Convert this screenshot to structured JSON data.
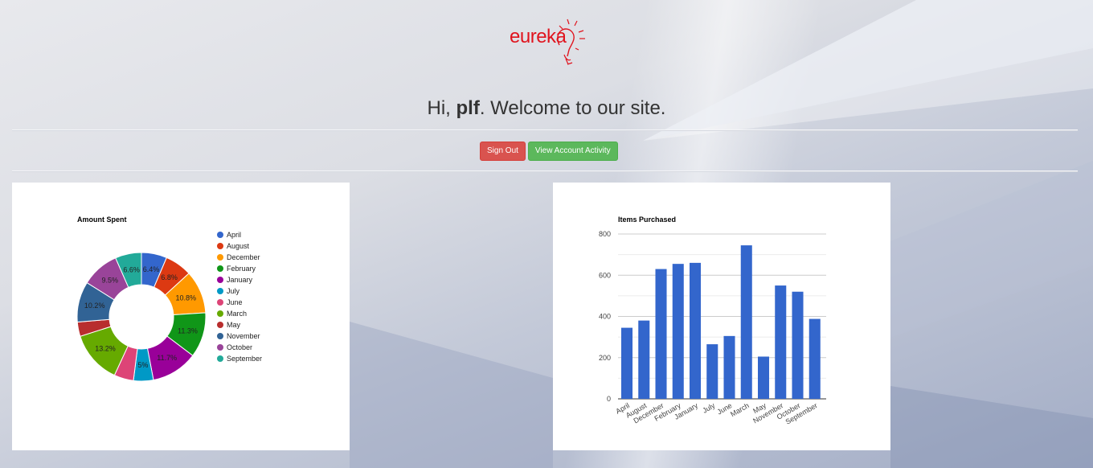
{
  "logo": {
    "text": "eureka"
  },
  "greeting": {
    "prefix": "Hi, ",
    "user": "plf",
    "suffix": ". Welcome to our site."
  },
  "buttons": {
    "sign_out": "Sign Out",
    "view_activity": "View Account Activity"
  },
  "colors": {
    "danger": "#d9534f",
    "success": "#5cb85c",
    "bar": "#3366cc",
    "logo": "#e0141e"
  },
  "chart_data": [
    {
      "type": "pie",
      "title": "Amount Spent",
      "donut": true,
      "legend_position": "right",
      "slices": [
        {
          "label": "April",
          "value": 6.4,
          "display": "6.4%",
          "color": "#3366cc"
        },
        {
          "label": "August",
          "value": 6.8,
          "display": "6.8%",
          "color": "#dc3912"
        },
        {
          "label": "December",
          "value": 10.8,
          "display": "10.8%",
          "color": "#ff9900"
        },
        {
          "label": "February",
          "value": 11.3,
          "display": "11.3%",
          "color": "#109618"
        },
        {
          "label": "January",
          "value": 11.7,
          "display": "11.7%",
          "color": "#990099"
        },
        {
          "label": "July",
          "value": 5.0,
          "display": "5%",
          "color": "#0099c6"
        },
        {
          "label": "June",
          "value": 4.9,
          "display": "",
          "color": "#dd4477"
        },
        {
          "label": "March",
          "value": 13.2,
          "display": "13.2%",
          "color": "#66aa00"
        },
        {
          "label": "May",
          "value": 3.6,
          "display": "",
          "color": "#b82e2e"
        },
        {
          "label": "November",
          "value": 10.2,
          "display": "10.2%",
          "color": "#316395"
        },
        {
          "label": "October",
          "value": 9.5,
          "display": "9.5%",
          "color": "#994499"
        },
        {
          "label": "September",
          "value": 6.6,
          "display": "6.6%",
          "color": "#22aa99"
        }
      ]
    },
    {
      "type": "bar",
      "title": "Items Purchased",
      "categories": [
        "April",
        "August",
        "December",
        "February",
        "January",
        "July",
        "June",
        "March",
        "May",
        "November",
        "October",
        "September"
      ],
      "values": [
        345,
        380,
        630,
        655,
        660,
        265,
        305,
        745,
        205,
        550,
        520,
        388
      ],
      "ylim": [
        0,
        800
      ],
      "yticks": [
        "0",
        "200",
        "400",
        "600",
        "800"
      ],
      "grid": true,
      "color": "#3366cc"
    }
  ]
}
